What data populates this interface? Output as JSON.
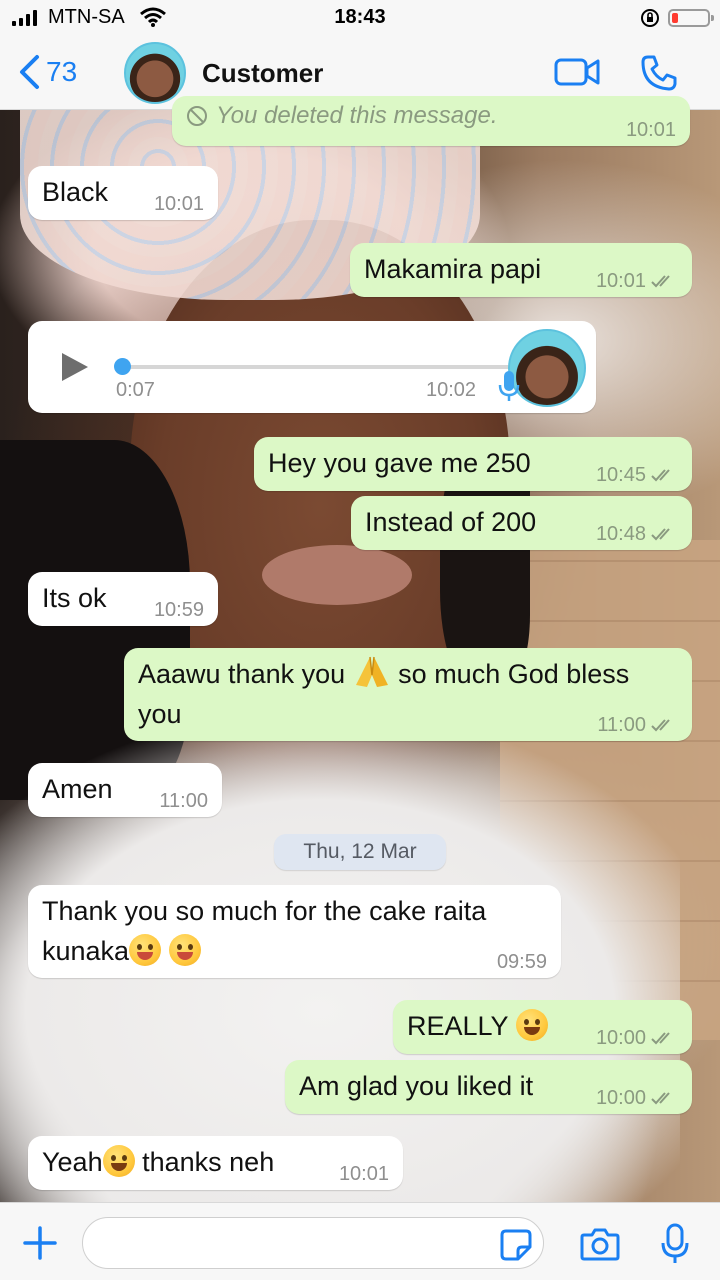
{
  "status_bar": {
    "carrier": "MTN-SA",
    "time": "18:43"
  },
  "header": {
    "back_count": "73",
    "contact_name": "Customer"
  },
  "messages": [
    {
      "dir": "out",
      "text": "You deleted this message.",
      "time": "10:01"
    },
    {
      "dir": "in",
      "text": "Black",
      "time": "10:01"
    },
    {
      "dir": "out",
      "text": "Makamira papi",
      "time": "10:01"
    },
    {
      "dir": "in",
      "type": "voice",
      "duration": "0:07",
      "time": "10:02"
    },
    {
      "dir": "out",
      "text": "Hey you gave me 250",
      "time": "10:45"
    },
    {
      "dir": "out",
      "text": "Instead of 200",
      "time": "10:48"
    },
    {
      "dir": "in",
      "text": "Its ok",
      "time": "10:59"
    },
    {
      "dir": "out",
      "text_a": "Aaawu thank you",
      "text_b": "so much God bless",
      "text_c": "you",
      "time": "11:00"
    },
    {
      "dir": "in",
      "text": "Amen",
      "time": "11:00"
    },
    {
      "dir": "in",
      "text_a": "Thank you so much for the cake raita",
      "text_b": "kunaka",
      "time": "09:59"
    },
    {
      "dir": "out",
      "text": "REALLY",
      "time": "10:00"
    },
    {
      "dir": "out",
      "text": "Am glad you liked it",
      "time": "10:00"
    },
    {
      "dir": "in",
      "text_a": "Yeah",
      "text_b": "thanks neh",
      "time": "10:01"
    }
  ],
  "date_separator": "Thu, 12 Mar",
  "composer": {
    "placeholder": "",
    "value": ""
  },
  "colors": {
    "accent": "#1a7ff2",
    "outgoing_bubble": "#dcf8c6",
    "incoming_bubble": "#ffffff",
    "read_ticks": "#8a9a80"
  },
  "icons": [
    "back-chevron-icon",
    "video-call-icon",
    "phone-icon",
    "play-icon",
    "microphone-icon",
    "plus-icon",
    "sticker-icon",
    "camera-icon",
    "smile-emoji-icon",
    "yum-emoji-icon",
    "pray-emoji-icon",
    "grin-emoji-icon"
  ]
}
